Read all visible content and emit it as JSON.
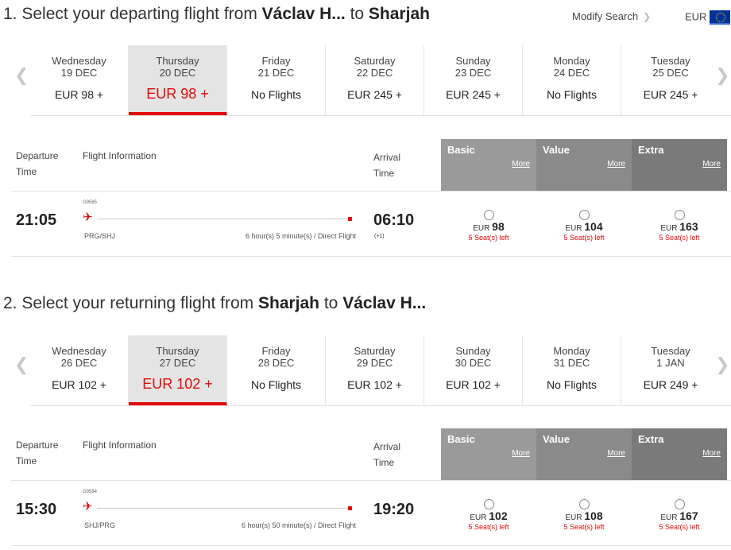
{
  "currency": "EUR",
  "modify_search": "Modify Search",
  "more": "More",
  "headers": {
    "departure": "Departure",
    "time": "Time",
    "flight_info": "Flight Information",
    "arrival": "Arrival"
  },
  "fare_names": [
    "Basic",
    "Value",
    "Extra"
  ],
  "outbound": {
    "title_prefix": "1. Select your departing flight from ",
    "origin": "Václav H...",
    "to": " to ",
    "destination": "Sharjah",
    "dates": [
      {
        "day": "Wednesday",
        "date": "19 DEC",
        "price": "EUR 98 +"
      },
      {
        "day": "Thursday",
        "date": "20 DEC",
        "price": "EUR 98 +"
      },
      {
        "day": "Friday",
        "date": "21 DEC",
        "price": "No Flights"
      },
      {
        "day": "Saturday",
        "date": "22 DEC",
        "price": "EUR 245 +"
      },
      {
        "day": "Sunday",
        "date": "23 DEC",
        "price": "EUR 245 +"
      },
      {
        "day": "Monday",
        "date": "24 DEC",
        "price": "No Flights"
      },
      {
        "day": "Tuesday",
        "date": "25 DEC",
        "price": "EUR 245 +"
      }
    ],
    "selected_index": 1,
    "flight": {
      "dep_time": "21:05",
      "flight_no": "G9585",
      "route": "PRG/SHJ",
      "duration": "6 hour(s) 5 minute(s) / Direct Flight",
      "arr_time": "06:10",
      "arr_offset": "(+1)",
      "fares": [
        {
          "cur": "EUR",
          "amount": "98",
          "seats": "5 Seat(s) left"
        },
        {
          "cur": "EUR",
          "amount": "104",
          "seats": "5 Seat(s) left"
        },
        {
          "cur": "EUR",
          "amount": "163",
          "seats": "5 Seat(s) left"
        }
      ]
    }
  },
  "return": {
    "title_prefix": "2. Select your returning flight from ",
    "origin": "Sharjah",
    "to": " to ",
    "destination": "Václav H...",
    "dates": [
      {
        "day": "Wednesday",
        "date": "26 DEC",
        "price": "EUR 102 +"
      },
      {
        "day": "Thursday",
        "date": "27 DEC",
        "price": "EUR 102 +"
      },
      {
        "day": "Friday",
        "date": "28 DEC",
        "price": "No Flights"
      },
      {
        "day": "Saturday",
        "date": "29 DEC",
        "price": "EUR 102 +"
      },
      {
        "day": "Sunday",
        "date": "30 DEC",
        "price": "EUR 102 +"
      },
      {
        "day": "Monday",
        "date": "31 DEC",
        "price": "No Flights"
      },
      {
        "day": "Tuesday",
        "date": "1 JAN",
        "price": "EUR 249 +"
      }
    ],
    "selected_index": 1,
    "flight": {
      "dep_time": "15:30",
      "flight_no": "G9584",
      "route": "SHJ/PRG",
      "duration": "6 hour(s) 50 minute(s) / Direct Flight",
      "arr_time": "19:20",
      "arr_offset": "",
      "fares": [
        {
          "cur": "EUR",
          "amount": "102",
          "seats": "5 Seat(s) left"
        },
        {
          "cur": "EUR",
          "amount": "108",
          "seats": "5 Seat(s) left"
        },
        {
          "cur": "EUR",
          "amount": "167",
          "seats": "5 Seat(s) left"
        }
      ]
    }
  }
}
